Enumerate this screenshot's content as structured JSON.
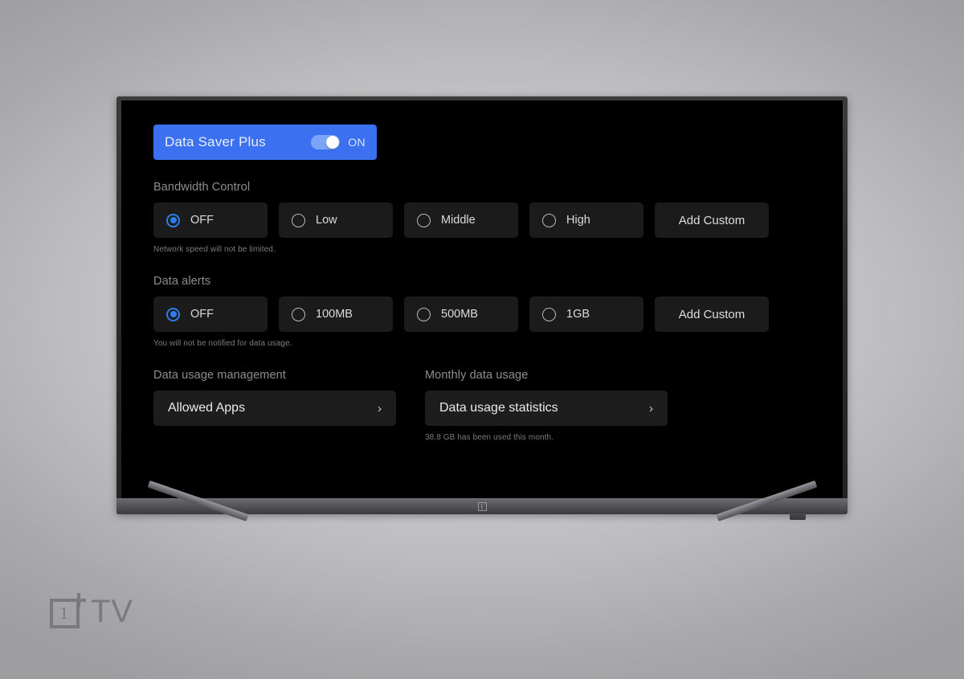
{
  "brand": {
    "mark_digit": "1",
    "name": "TV"
  },
  "banner": {
    "title": "Data Saver Plus",
    "toggle_state_label": "ON",
    "toggle_on": true,
    "accent_color": "#3b71f0"
  },
  "sections": {
    "bandwidth": {
      "title": "Bandwidth Control",
      "options": [
        {
          "label": "OFF",
          "selected": true,
          "has_radio": true
        },
        {
          "label": "Low",
          "selected": false,
          "has_radio": true
        },
        {
          "label": "Middle",
          "selected": false,
          "has_radio": true
        },
        {
          "label": "High",
          "selected": false,
          "has_radio": true
        },
        {
          "label": "Add Custom",
          "selected": false,
          "has_radio": false
        }
      ],
      "hint": "Network speed will not be limited."
    },
    "alerts": {
      "title": "Data alerts",
      "options": [
        {
          "label": "OFF",
          "selected": true,
          "has_radio": true
        },
        {
          "label": "100MB",
          "selected": false,
          "has_radio": true
        },
        {
          "label": "500MB",
          "selected": false,
          "has_radio": true
        },
        {
          "label": "1GB",
          "selected": false,
          "has_radio": true
        },
        {
          "label": "Add Custom",
          "selected": false,
          "has_radio": false
        }
      ],
      "hint": "You will not be notified for data usage."
    },
    "management": {
      "title": "Data usage management",
      "card_label": "Allowed Apps",
      "chevron": "›"
    },
    "monthly": {
      "title": "Monthly data usage",
      "card_label": "Data usage statistics",
      "chevron": "›",
      "hint": "38.8 GB has been used this month."
    }
  },
  "colors": {
    "screen_bg": "#000000",
    "card_bg": "#1b1b1b",
    "radio_selected": "#2e7df0",
    "section_title": "#8d8d8f",
    "hint": "#7b7b7b"
  }
}
